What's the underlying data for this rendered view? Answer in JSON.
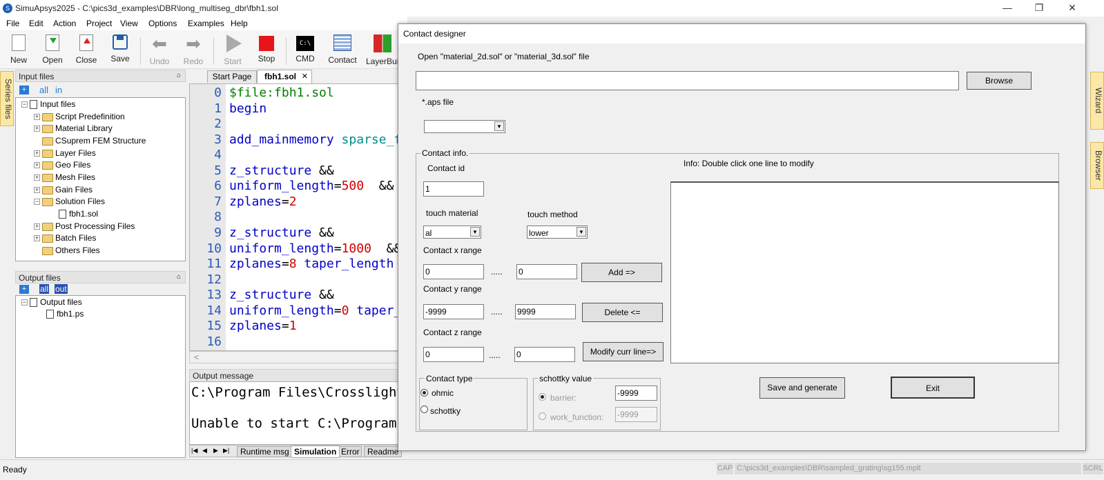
{
  "window": {
    "title": "SimuApsys2025 - C:\\pics3d_examples\\DBR\\long_multiseg_dbr\\fbh1.sol",
    "minimize": "—",
    "restore": "❐",
    "close": "✕"
  },
  "menu": [
    "File",
    "Edit",
    "Action",
    "Project",
    "View",
    "Options",
    "Examples",
    "Help"
  ],
  "toolbar": {
    "new": "New",
    "open": "Open",
    "close": "Close",
    "save": "Save",
    "undo": "Undo",
    "redo": "Redo",
    "start": "Start",
    "stop": "Stop",
    "cmd": "CMD",
    "cmd_icon_text": "C:\\",
    "contact": "Contact",
    "layerbuilder": "LayerBui"
  },
  "side_tabs": {
    "series": "Series files",
    "wizard": "Wizard",
    "browser": "Browser"
  },
  "input_panel": {
    "title": "Input files",
    "pin": "⌂",
    "toolbar_all": "all",
    "toolbar_in": "in",
    "root": "Input files",
    "items": [
      "Script Predefinition",
      "Material Library",
      "CSuprem FEM Structure",
      "Layer Files",
      "Geo Files",
      "Mesh Files",
      "Gain Files",
      "Solution Files",
      "Post Processing Files",
      "Batch Files",
      "Others Files"
    ],
    "solution_child": "fbh1.sol"
  },
  "output_panel": {
    "title": "Output files",
    "toolbar_all": "all",
    "toolbar_out": "out",
    "root": "Output files",
    "child": "fbh1.ps"
  },
  "editor": {
    "tabs": [
      "Start Page",
      "fbh1.sol"
    ],
    "tab_close": "✕",
    "line_numbers": [
      "0",
      "1",
      "2",
      "3",
      "4",
      "5",
      "6",
      "7",
      "8",
      "9",
      "10",
      "11",
      "12",
      "13",
      "14",
      "15",
      "16"
    ],
    "lines": {
      "l0": "$file:fbh1.sol",
      "l1": "begin",
      "l3a": "add_mainmemory",
      "l3b": " sparse_f",
      "l5a": "z_structure",
      "l5b": " &&",
      "l6a": "uniform_length",
      "l6b": "=",
      "l6c": "500",
      "l6d": "  &&",
      "l7a": "zplanes",
      "l7b": "=",
      "l7c": "2",
      "l9a": "z_structure",
      "l9b": " &&",
      "l10a": "uniform_length",
      "l10b": "=",
      "l10c": "1000",
      "l10d": "  &&",
      "l11a": "zplanes",
      "l11b": "=",
      "l11c": "8",
      "l11d": " taper_length",
      "l13a": "z_structure",
      "l13b": " &&",
      "l14a": "uniform_length",
      "l14b": "=",
      "l14c": "0",
      "l14d": " taper_",
      "l15a": "zplanes",
      "l15b": "=",
      "l15c": "1"
    },
    "scroll_left": "<"
  },
  "output_message": {
    "title": "Output message",
    "line1": "C:\\Program Files\\Crosslight",
    "line2": "Unable to start C:\\Program F",
    "nav": [
      "|◀",
      "◀",
      "▶",
      "▶|"
    ],
    "tabs": [
      "Runtime msg",
      "Simulation",
      "Error",
      "Readme"
    ]
  },
  "status": {
    "ready": "Ready",
    "cap": "CAP",
    "path": "C:\\pics3d_examples\\DBR\\sampled_grating\\sg155.mplt",
    "scrl": "SCRL"
  },
  "dialog": {
    "title": "Contact designer",
    "open_label": "Open \"material_2d.sol\" or \"material_3d.sol\" file",
    "file_path": "",
    "browse": "Browse",
    "aps_label": "*.aps file",
    "aps_value": "",
    "contact_info": "Contact info.",
    "contact_id_label": "Contact id",
    "contact_id": "1",
    "info_hint": "Info: Double click one line to modify",
    "touch_material_label": "touch material",
    "touch_material": "al",
    "touch_method_label": "touch method",
    "touch_method": "lower",
    "x_range_label": "Contact x range",
    "x_min": "0",
    "x_max": "0",
    "y_range_label": "Contact y range",
    "y_min": "-9999",
    "y_max": "9999",
    "z_range_label": "Contact z range",
    "z_min": "0",
    "z_max": "0",
    "range_sep": ".....",
    "add": "Add =>",
    "delete": "Delete <=",
    "modify": "Modify curr line=>",
    "contact_type_label": "Contact type",
    "ohmic": "ohmic",
    "schottky": "schottky",
    "schottky_value_label": "schottky value",
    "barrier_label": "barrier:",
    "barrier_value": "-9999",
    "work_function_label": "work_function:",
    "work_function_value": "-9999",
    "save_generate": "Save and generate",
    "exit": "Exit"
  }
}
